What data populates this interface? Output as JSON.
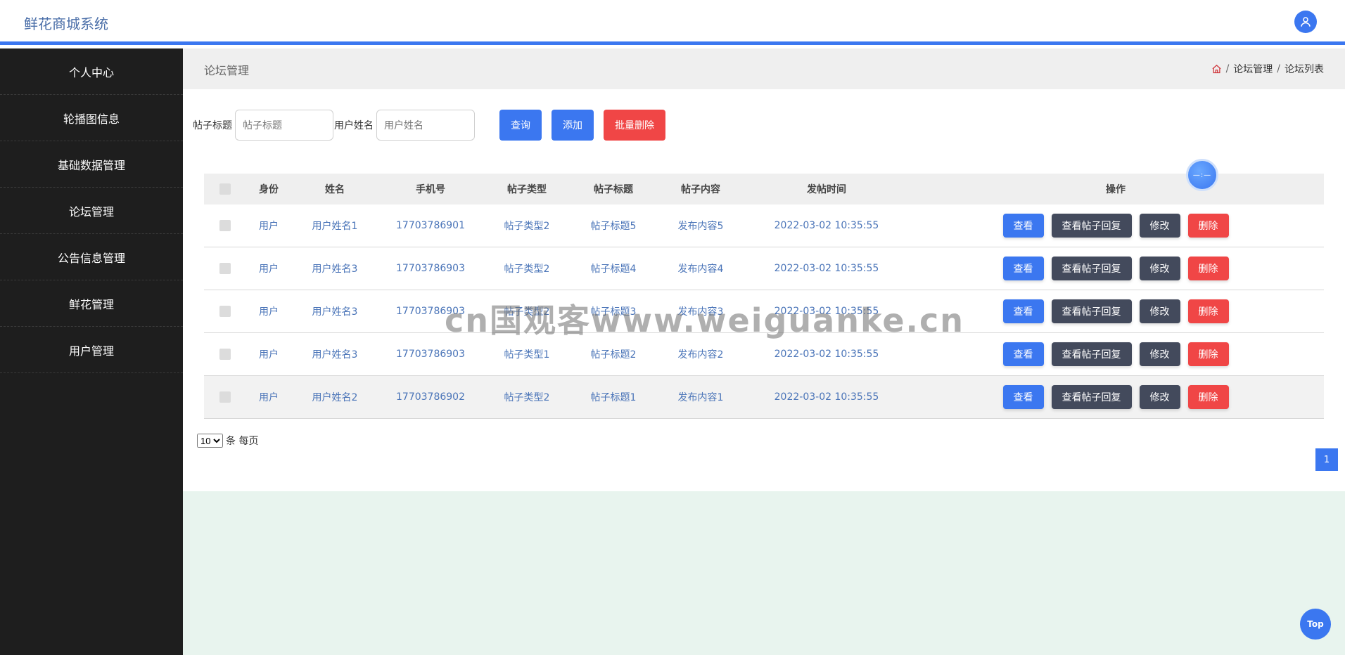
{
  "app": {
    "title": "鲜花商城系统"
  },
  "sidebar": {
    "items": [
      {
        "label": "个人中心"
      },
      {
        "label": "轮播图信息"
      },
      {
        "label": "基础数据管理"
      },
      {
        "label": "论坛管理"
      },
      {
        "label": "公告信息管理"
      },
      {
        "label": "鲜花管理"
      },
      {
        "label": "用户管理"
      }
    ]
  },
  "page": {
    "title": "论坛管理",
    "breadcrumb": [
      "论坛管理",
      "论坛列表"
    ],
    "breadcrumb_sep": "/"
  },
  "search": {
    "title_label": "帖子标题",
    "title_placeholder": "帖子标题",
    "user_label": "用户姓名",
    "user_placeholder": "用户姓名",
    "query_label": "查询",
    "add_label": "添加",
    "batch_delete_label": "批量删除"
  },
  "table": {
    "headers": [
      "身份",
      "姓名",
      "手机号",
      "帖子类型",
      "帖子标题",
      "帖子内容",
      "发帖时间",
      "操作"
    ],
    "rows": [
      {
        "role": "用户",
        "name": "用户姓名1",
        "phone": "17703786901",
        "type": "帖子类型2",
        "title": "帖子标题5",
        "content": "发布内容5",
        "time": "2022-03-02 10:35:55"
      },
      {
        "role": "用户",
        "name": "用户姓名3",
        "phone": "17703786903",
        "type": "帖子类型2",
        "title": "帖子标题4",
        "content": "发布内容4",
        "time": "2022-03-02 10:35:55"
      },
      {
        "role": "用户",
        "name": "用户姓名3",
        "phone": "17703786903",
        "type": "帖子类型2",
        "title": "帖子标题3",
        "content": "发布内容3",
        "time": "2022-03-02 10:35:55"
      },
      {
        "role": "用户",
        "name": "用户姓名3",
        "phone": "17703786903",
        "type": "帖子类型1",
        "title": "帖子标题2",
        "content": "发布内容2",
        "time": "2022-03-02 10:35:55"
      },
      {
        "role": "用户",
        "name": "用户姓名2",
        "phone": "17703786902",
        "type": "帖子类型2",
        "title": "帖子标题1",
        "content": "发布内容1",
        "time": "2022-03-02 10:35:55"
      }
    ],
    "actions": {
      "view": "查看",
      "view_replies": "查看帖子回复",
      "edit": "修改",
      "delete": "删除"
    }
  },
  "pager": {
    "page_size": "10",
    "page_size_options": [
      "10"
    ],
    "per_page_label": "条 每页",
    "current_page": "1"
  },
  "floating": {
    "label": "—:—"
  },
  "watermark": "cn国观客www.weiguanke.cn",
  "top_button": "Top",
  "colors": {
    "accent": "#3b77f0",
    "danger": "#f04646",
    "dark_button": "#434a5c",
    "sidebar_bg": "#1e1e1e"
  },
  "icons": {
    "avatar": "user-icon",
    "breadcrumb_home": "home-icon"
  }
}
